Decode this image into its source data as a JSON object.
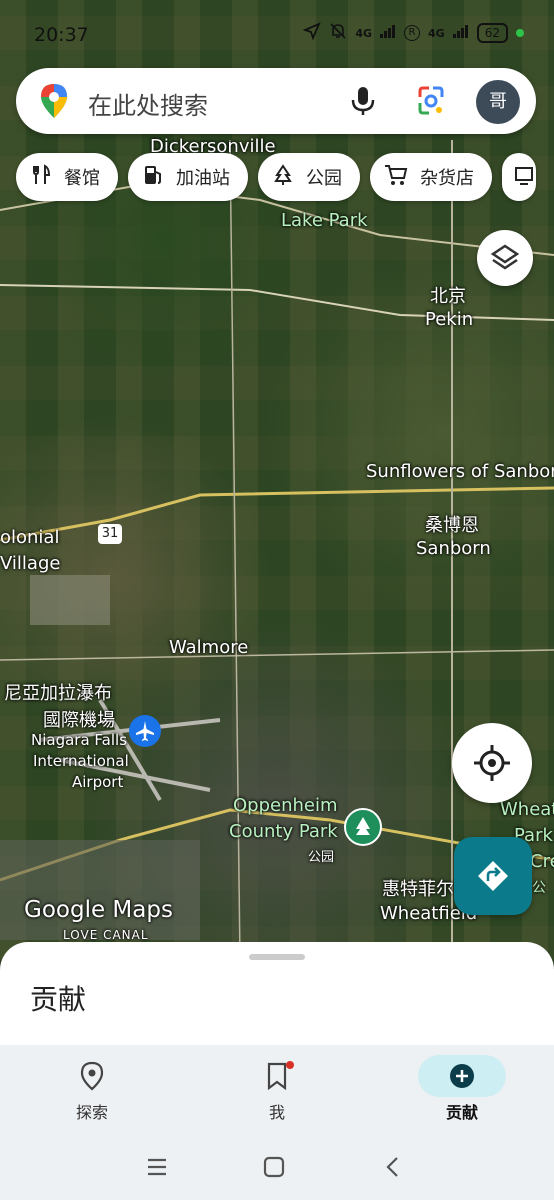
{
  "status": {
    "time": "20:37",
    "network1": "4G",
    "network2": "4G",
    "battery": "62"
  },
  "search": {
    "placeholder": "在此处搜索",
    "avatar_letter": "哥"
  },
  "chips": [
    {
      "label": "餐馆",
      "icon": "restaurant-icon"
    },
    {
      "label": "加油站",
      "icon": "gas-station-icon"
    },
    {
      "label": "公园",
      "icon": "park-icon"
    },
    {
      "label": "杂货店",
      "icon": "grocery-cart-icon"
    }
  ],
  "map": {
    "labels": {
      "dickersonville": "Dickersonville",
      "lake_park": "Lake Park",
      "pekin_cn": "北京",
      "pekin": "Pekin",
      "sunflowers": "Sunflowers of Sanborn",
      "colonial1": "olonial",
      "colonial2": "Village",
      "route": "31",
      "sanborn_cn": "桑博恩",
      "sanborn": "Sanborn",
      "walmore": "Walmore",
      "airport_cn1": "尼亞加拉瀑布",
      "airport_cn2": "國際機場",
      "airport1": "Niagara Falls",
      "airport2": "International",
      "airport3": "Airport",
      "oppenheim1": "Oppenheim",
      "oppenheim2": "County Park",
      "park_cn": "公园",
      "wheatfield_cn": "惠特菲尔",
      "wheatfield": "Wheatfield",
      "wheat_edge": "Wheat",
      "park_edge": "Park",
      "cre_edge": "Cre",
      "gong_edge": "公",
      "logo": "Google Maps",
      "love_canal": "LOVE CANAL"
    }
  },
  "sheet": {
    "title": "贡献"
  },
  "nav": [
    {
      "label": "探索",
      "icon": "explore-pin-icon"
    },
    {
      "label": "我",
      "icon": "bookmark-icon"
    },
    {
      "label": "贡献",
      "icon": "add-contribution-icon"
    }
  ]
}
